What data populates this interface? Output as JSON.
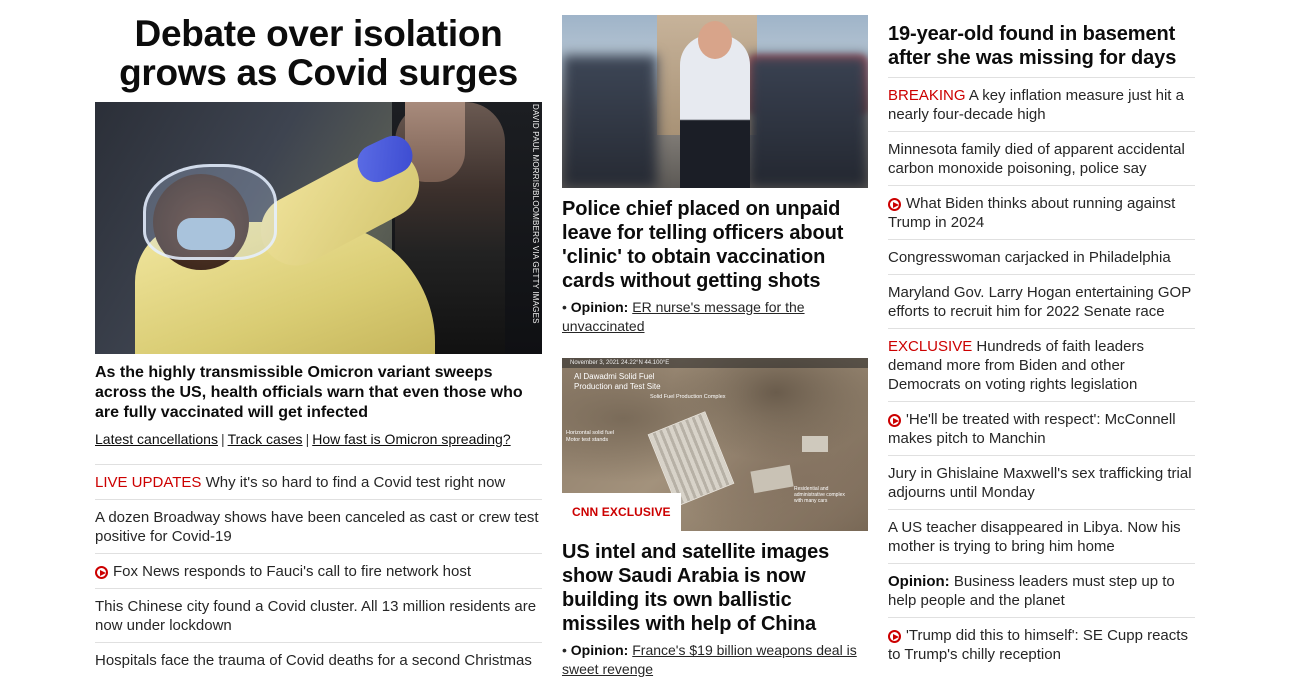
{
  "lead": {
    "headline": "Debate over isolation grows as Covid surges",
    "photo_credit": "DAVID PAUL MORRIS/BLOOMBERG VIA GETTY IMAGES",
    "hero_headline": "As the highly transmissible Omicron variant sweeps across the US, health officials warn that even those who are fully vaccinated will get infected",
    "related_links": [
      "Latest cancellations",
      "Track cases",
      "How fast is Omicron spreading?"
    ],
    "related_separator": "|",
    "list": [
      {
        "kicker": "LIVE UPDATES",
        "text": "Why it's so hard to find a Covid test right now"
      },
      {
        "text": "A dozen Broadway shows have been canceled as cast or crew test positive for Covid-19"
      },
      {
        "video": true,
        "text": "Fox News responds to Fauci's call to fire network host"
      },
      {
        "text": "This Chinese city found a Covid cluster. All 13 million residents are now under lockdown"
      },
      {
        "text": "Hospitals face the trauma of Covid deaths for a second Christmas"
      }
    ]
  },
  "middle": {
    "story1": {
      "headline": "Police chief placed on unpaid leave for telling officers about 'clinic' to obtain vaccination cards without getting shots",
      "bullet": "•",
      "opinion_label": "Opinion:",
      "opinion_text": "ER nurse's message for the unvaccinated"
    },
    "story2": {
      "badge": "CNN EXCLUSIVE",
      "image_topbar": "November 3, 2021     24.22°N 44.100°E",
      "image_label_main": "Al Dawadmi Solid Fuel Production and Test Site",
      "image_label_complex": "Solid Fuel Production Complex",
      "image_label_left": "Horizontal solid fuel Motor test stands",
      "image_label_right": "Residential and administrative complex with many cars",
      "headline": "US intel and satellite images show Saudi Arabia is now building its own ballistic missiles with help of China",
      "bullet": "•",
      "opinion_label": "Opinion:",
      "opinion_text": "France's $19 billion weapons deal is sweet revenge"
    }
  },
  "right": {
    "headline": "19-year-old found in basement after she was missing for days",
    "list": [
      {
        "kicker": "BREAKING",
        "kicker_style": "red",
        "text": "A key inflation measure just hit a nearly four-decade high"
      },
      {
        "text": "Minnesota family died of apparent accidental carbon monoxide poisoning, police say"
      },
      {
        "video": true,
        "text": "What Biden thinks about running against Trump in 2024"
      },
      {
        "text": "Congresswoman carjacked in Philadelphia"
      },
      {
        "text": "Maryland Gov. Larry Hogan entertaining GOP efforts to recruit him for 2022 Senate race"
      },
      {
        "kicker": "EXCLUSIVE",
        "kicker_style": "red",
        "text": "Hundreds of faith leaders demand more from Biden and other Democrats on voting rights legislation"
      },
      {
        "video": true,
        "text": "'He'll be treated with respect': McConnell makes pitch to Manchin"
      },
      {
        "text": "Jury in Ghislaine Maxwell's sex trafficking trial adjourns until Monday"
      },
      {
        "text": "A US teacher disappeared in Libya. Now his mother is trying to bring him home"
      },
      {
        "kicker": "Opinion:",
        "kicker_style": "bold",
        "text": "Business leaders must step up to help people and the planet"
      },
      {
        "video": true,
        "text": "'Trump did this to himself': SE Cupp reacts to Trump's chilly reception"
      }
    ]
  },
  "colors": {
    "accent_red": "#cc0000",
    "text": "#0c0c0c",
    "divider": "#e0e0e0"
  },
  "icons": {
    "video": "play-circle-icon"
  }
}
